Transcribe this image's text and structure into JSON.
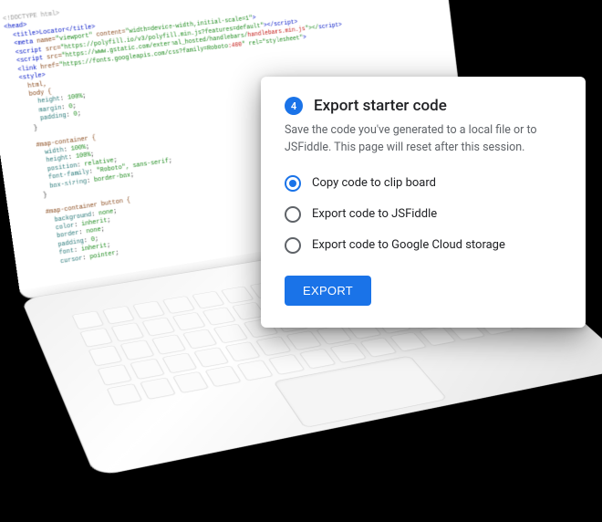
{
  "export_card": {
    "step": "4",
    "title": "Export starter code",
    "description": "Save the code you've generated to a local file or to JSFiddle. This page will reset after this session.",
    "options": [
      {
        "label": "Copy code to clip board",
        "selected": true
      },
      {
        "label": "Export code to JSFiddle",
        "selected": false
      },
      {
        "label": "Export code to Google Cloud storage",
        "selected": false
      }
    ],
    "button": "EXPORT"
  },
  "code": {
    "l1": "<!DOCTYPE html>",
    "l2": "<head>",
    "l3": "  <title>Locator</title>",
    "l4a": "  <meta ",
    "l4b": "name=",
    "l4c": "\"viewport\"",
    "l4d": " content=",
    "l4e": "\"width=device-width,initial-scale=1\"",
    "l4f": ">",
    "l5a": "  <script ",
    "l5b": "src=",
    "l5c": "\"https://polyfill.io/v3/polyfill.min.js?features=default\"",
    "l5d": "></",
    "l5e": "script",
    "l5f": ">",
    "l6a": "  <script ",
    "l6b": "src=",
    "l6c": "\"https://www.gstatic.com/external_hosted/handlebars/",
    "l6d": "handlebars.min.js",
    "l6e": "\"></",
    "l6f": "script",
    "l6g": ">",
    "l7a": "  <link ",
    "l7b": "href=",
    "l7c": "\"https://fonts.googleapis.com/css?family=Roboto",
    "l7d": ":400",
    "l7e": "\" rel=",
    "l7f": "\"stylesheet\"",
    "l7g": ">",
    "l8": "  <style>",
    "l9": "    html,",
    "l10": "    body {",
    "l11a": "      ",
    "l11b": "height",
    "l11c": ": ",
    "l11d": "100%",
    "l11e": ";",
    "l12a": "      ",
    "l12b": "margin",
    "l12c": ": ",
    "l12d": "0",
    "l12e": ";",
    "l13a": "      ",
    "l13b": "padding",
    "l13c": ": ",
    "l13d": "0",
    "l13e": ";",
    "l14": "    }",
    "l15": "",
    "l16": "    #map-container {",
    "l17a": "      ",
    "l17b": "width",
    "l17c": ": ",
    "l17d": "100%",
    "l17e": ";",
    "l18a": "      ",
    "l18b": "height",
    "l18c": ": ",
    "l18d": "100%",
    "l18e": ";",
    "l19a": "      ",
    "l19b": "position",
    "l19c": ": ",
    "l19d": "relative",
    "l19e": ";",
    "l20a": "      ",
    "l20b": "font-family",
    "l20c": ": ",
    "l20d": "\"Roboto\", sans-serif",
    "l20e": ";",
    "l21a": "      ",
    "l21b": "box-sizing",
    "l21c": ": ",
    "l21d": "border-box",
    "l21e": ";",
    "l22": "    }",
    "l23": "",
    "l24": "    #map-container button {",
    "l25a": "      ",
    "l25b": "background",
    "l25c": ": ",
    "l25d": "none",
    "l25e": ";",
    "l26a": "      ",
    "l26b": "color",
    "l26c": ": ",
    "l26d": "inherit",
    "l26e": ";",
    "l27a": "      ",
    "l27b": "border",
    "l27c": ": ",
    "l27d": "none",
    "l27e": ";",
    "l28a": "      ",
    "l28b": "padding",
    "l28c": ": ",
    "l28d": "0",
    "l28e": ";",
    "l29a": "      ",
    "l29b": "font",
    "l29c": ": ",
    "l29d": "inherit",
    "l29e": ";",
    "l30a": "      ",
    "l30b": "cursor",
    "l30c": ": ",
    "l30d": "pointer",
    "l30e": ";"
  }
}
